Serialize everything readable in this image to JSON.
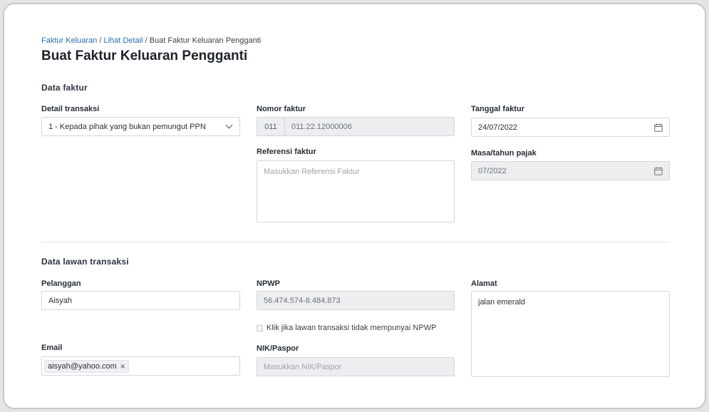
{
  "breadcrumb": {
    "item1": "Faktur Keluaran",
    "item2": "Lihat Detail",
    "current": "Buat Faktur Keluaran Pengganti",
    "separator": "/"
  },
  "page_title": "Buat Faktur Keluaran Pengganti",
  "data_faktur": {
    "section_title": "Data faktur",
    "detail_transaksi": {
      "label": "Detail transaksi",
      "value": "1 - Kepada pihak yang bukan pemungut PPN",
      "icon": "chevron-down-icon"
    },
    "nomor_faktur": {
      "label": "Nomor faktur",
      "prefix": "011",
      "value": "011.22.12000006"
    },
    "referensi_faktur": {
      "label": "Referensi faktur",
      "placeholder": "Masukkan Referensi Faktur"
    },
    "tanggal_faktur": {
      "label": "Tanggal faktur",
      "value": "24/07/2022",
      "icon": "calendar-icon"
    },
    "masa_tahun_pajak": {
      "label": "Masa/tahun pajak",
      "value": "07/2022",
      "icon": "calendar-icon"
    }
  },
  "data_lawan_transaksi": {
    "section_title": "Data lawan transaksi",
    "pelanggan": {
      "label": "Pelanggan",
      "value": "Aisyah"
    },
    "npwp": {
      "label": "NPWP",
      "value": "56.474.574-8.484.873"
    },
    "no_npwp_checkbox": {
      "label": "Klik jika lawan transaksi tidak mempunyai NPWP",
      "checked": false
    },
    "alamat": {
      "label": "Alamat",
      "value": "jalan emerald"
    },
    "email": {
      "label": "Email",
      "tag": "aisyah@yahoo.com",
      "tag_close": "×"
    },
    "nik_paspor": {
      "label": "NIK/Paspor",
      "placeholder": "Masukkan NIK/Paspor"
    }
  },
  "colors": {
    "link": "#2b6cb0",
    "disabled_bg": "#eceef0",
    "border": "#d3d6da"
  }
}
